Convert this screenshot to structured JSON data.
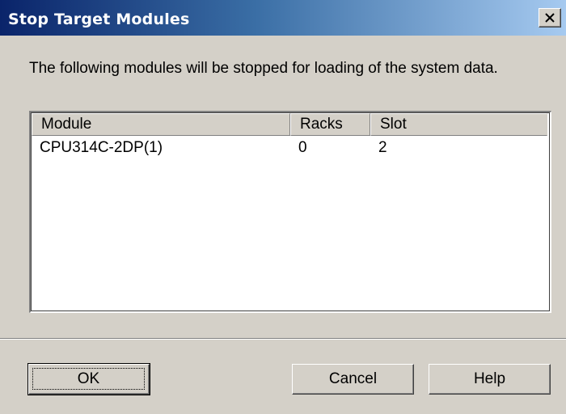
{
  "window": {
    "title": "Stop Target Modules",
    "close_icon": "close-icon"
  },
  "message": "The following modules will be stopped for loading of the system data.",
  "table": {
    "columns": [
      "Module",
      "Racks",
      "Slot"
    ],
    "rows": [
      [
        "CPU314C-2DP(1)",
        "0",
        "2"
      ]
    ]
  },
  "buttons": {
    "ok": "OK",
    "cancel": "Cancel",
    "help": "Help"
  }
}
